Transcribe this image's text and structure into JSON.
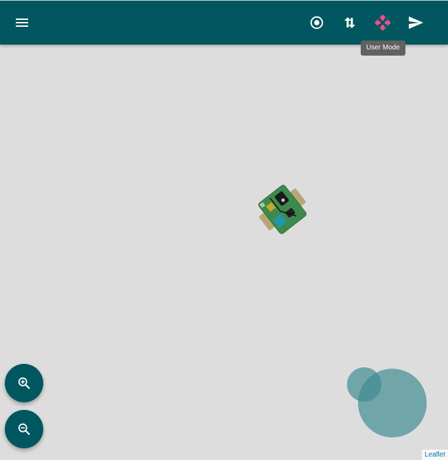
{
  "toolbar": {
    "menu_icon": "menu-icon",
    "center_icon": "target-icon",
    "swap_icon": "swap-vertical-icon",
    "usermode_icon": "move-arrows-icon",
    "send_icon": "send-icon",
    "usermode_tooltip": "User Mode"
  },
  "map": {
    "zoom_in_icon": "zoom-in-icon",
    "zoom_out_icon": "zoom-out-icon",
    "attribution": "Leaflet"
  },
  "colors": {
    "toolbar_bg": "#00575f",
    "accent_pink": "#f0508c",
    "map_bg": "#dddddd",
    "blob": "#3d8b91"
  }
}
